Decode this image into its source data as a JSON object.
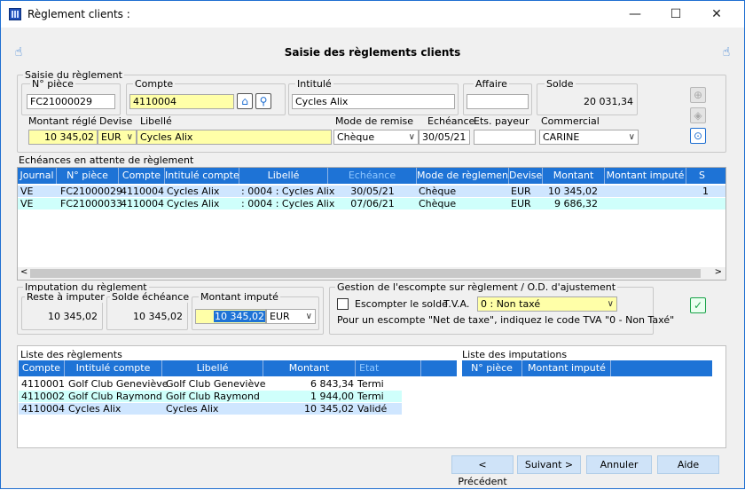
{
  "window": {
    "title": "Règlement clients :",
    "minimize": "—",
    "maximize": "☐",
    "close": "✕"
  },
  "header": {
    "title": "Saisie des règlements clients"
  },
  "saisie": {
    "legend": "Saisie du règlement",
    "npiece_label": "N° pièce",
    "npiece_value": "FC21000029",
    "compte_label": "Compte",
    "compte_value": "4110004",
    "intitule_label": "Intitulé",
    "intitule_value": "Cycles Alix",
    "affaire_label": "Affaire",
    "affaire_value": "",
    "solde_label": "Solde",
    "solde_value": "20 031,34",
    "montant_label": "Montant réglé",
    "montant_value": "10 345,02",
    "devise_label": "Devise",
    "devise_value": "EUR",
    "libelle_label": "Libellé",
    "libelle_value": "Cycles Alix",
    "mode_label": "Mode de remise",
    "mode_value": "Chèque",
    "echeance_label": "Echéance",
    "echeance_value": "30/05/21",
    "payeur_label": "Ets. payeur",
    "payeur_value": "",
    "commercial_label": "Commercial",
    "commercial_value": "CARINE"
  },
  "echeances": {
    "legend": "Echéances en attente de règlement",
    "columns": [
      "Journal",
      "N° pièce",
      "Compte",
      "Intitulé compte",
      "Libellé",
      "Echéance",
      "Mode de règlement",
      "Devise",
      "Montant",
      "Montant imputé",
      "S"
    ],
    "rows": [
      [
        "VE",
        "FC21000029",
        "4110004",
        "Cycles Alix",
        ": 0004 : Cycles Alix",
        "30/05/21",
        "Chèque",
        "EUR",
        "10 345,02",
        "",
        "1"
      ],
      [
        "VE",
        "FC21000033",
        "4110004",
        "Cycles Alix",
        ": 0004 : Cycles Alix",
        "07/06/21",
        "Chèque",
        "EUR",
        "9 686,32",
        "",
        ""
      ]
    ]
  },
  "imputation": {
    "legend": "Imputation du règlement",
    "reste_label": "Reste à imputer",
    "reste_value": "10 345,02",
    "solde_label": "Solde échéance",
    "solde_value": "10 345,02",
    "montant_label": "Montant imputé",
    "montant_value": "10 345,02",
    "devise_value": "EUR"
  },
  "escompte": {
    "legend": "Gestion de l'escompte sur règlement / O.D. d'ajustement",
    "checkbox_label": "Escompter le solde",
    "tva_label": "T.V.A.",
    "tva_value": "0  : Non taxé",
    "note": "Pour un escompte \"Net de taxe\", indiquez le code TVA \"0 - Non Taxé\""
  },
  "reglements": {
    "title": "Liste des règlements",
    "columns": [
      "Compte",
      "Intitulé compte",
      "Libellé",
      "Montant",
      "Etat"
    ],
    "rows": [
      [
        "4110001",
        "Golf Club Geneviève",
        "Golf Club Geneviève",
        "6 843,34",
        "Termi"
      ],
      [
        "4110002",
        "Golf Club Raymond",
        "Golf Club Raymond",
        "1 944,00",
        "Termi"
      ],
      [
        "4110004",
        "Cycles Alix",
        "Cycles Alix",
        "10 345,02",
        "Validé"
      ]
    ]
  },
  "imputations": {
    "title": "Liste des imputations",
    "columns": [
      "N° pièce",
      "Montant imputé"
    ]
  },
  "footer": {
    "prev": "< Précédent",
    "next": "Suivant >",
    "cancel": "Annuler",
    "help": "Aide"
  }
}
